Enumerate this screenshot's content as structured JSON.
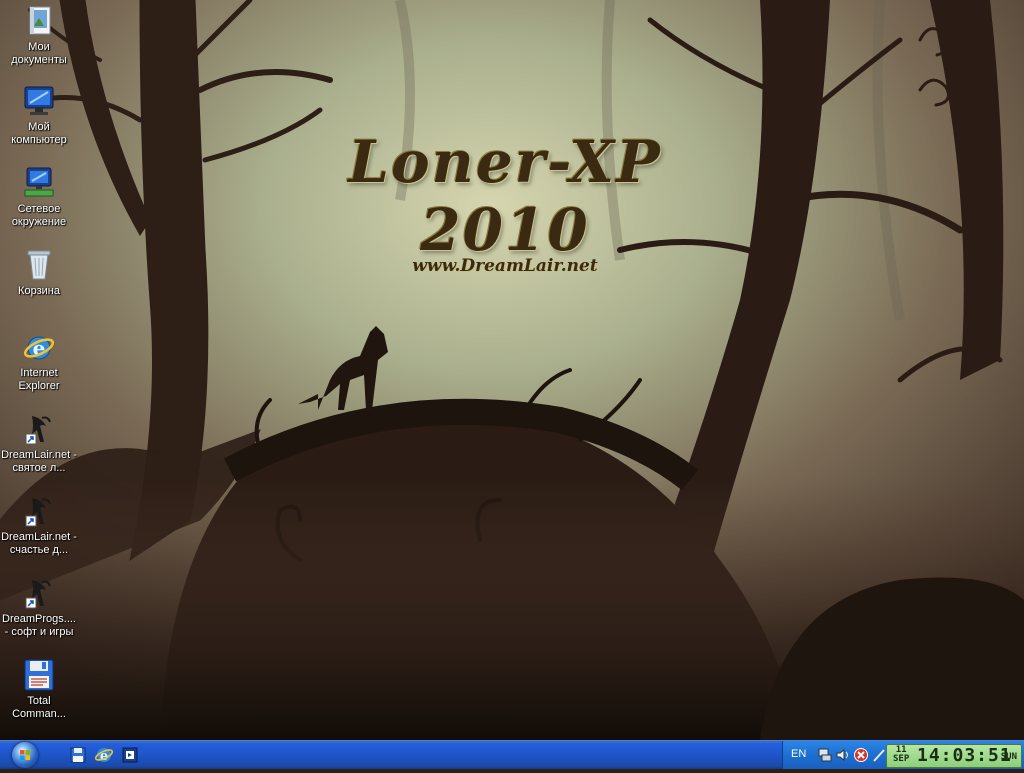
{
  "wallpaper": {
    "title": "Loner-XP 2010",
    "url": "www.DreamLair.net"
  },
  "desktop_icons": [
    {
      "label": "Мои документы",
      "icon": "my-documents-icon"
    },
    {
      "label": "Мой компьютер",
      "icon": "my-computer-icon"
    },
    {
      "label": "Сетевое окружение",
      "icon": "network-places-icon"
    },
    {
      "label": "Корзина",
      "icon": "recycle-bin-icon"
    },
    {
      "label": "Internet Explorer",
      "icon": "internet-explorer-icon"
    },
    {
      "label": "DreamLair.net - святое л...",
      "icon": "shortcut-icon"
    },
    {
      "label": "DreamLair.net - счастье д...",
      "icon": "shortcut-icon"
    },
    {
      "label": "DreamProgs.... - софт и игры",
      "icon": "shortcut-icon"
    },
    {
      "label": "Total Comman...",
      "icon": "total-commander-icon"
    }
  ],
  "taskbar": {
    "start_icon": "windows-orb-icon",
    "quick_launch": [
      "show-desktop-icon",
      "internet-explorer-icon",
      "windows-media-icon"
    ],
    "tray": {
      "language": "EN",
      "icons": [
        "network-icon",
        "volume-icon",
        "security-alert-icon",
        "clock-icon"
      ]
    },
    "clock": {
      "day": "11",
      "month": "SEP",
      "time": "14:03:51",
      "weekday": "SUN"
    }
  },
  "colors": {
    "taskbar_blue": "#245edb",
    "clock_green": "#9cd98a",
    "wallpaper_fog": "#a8ad8a"
  }
}
